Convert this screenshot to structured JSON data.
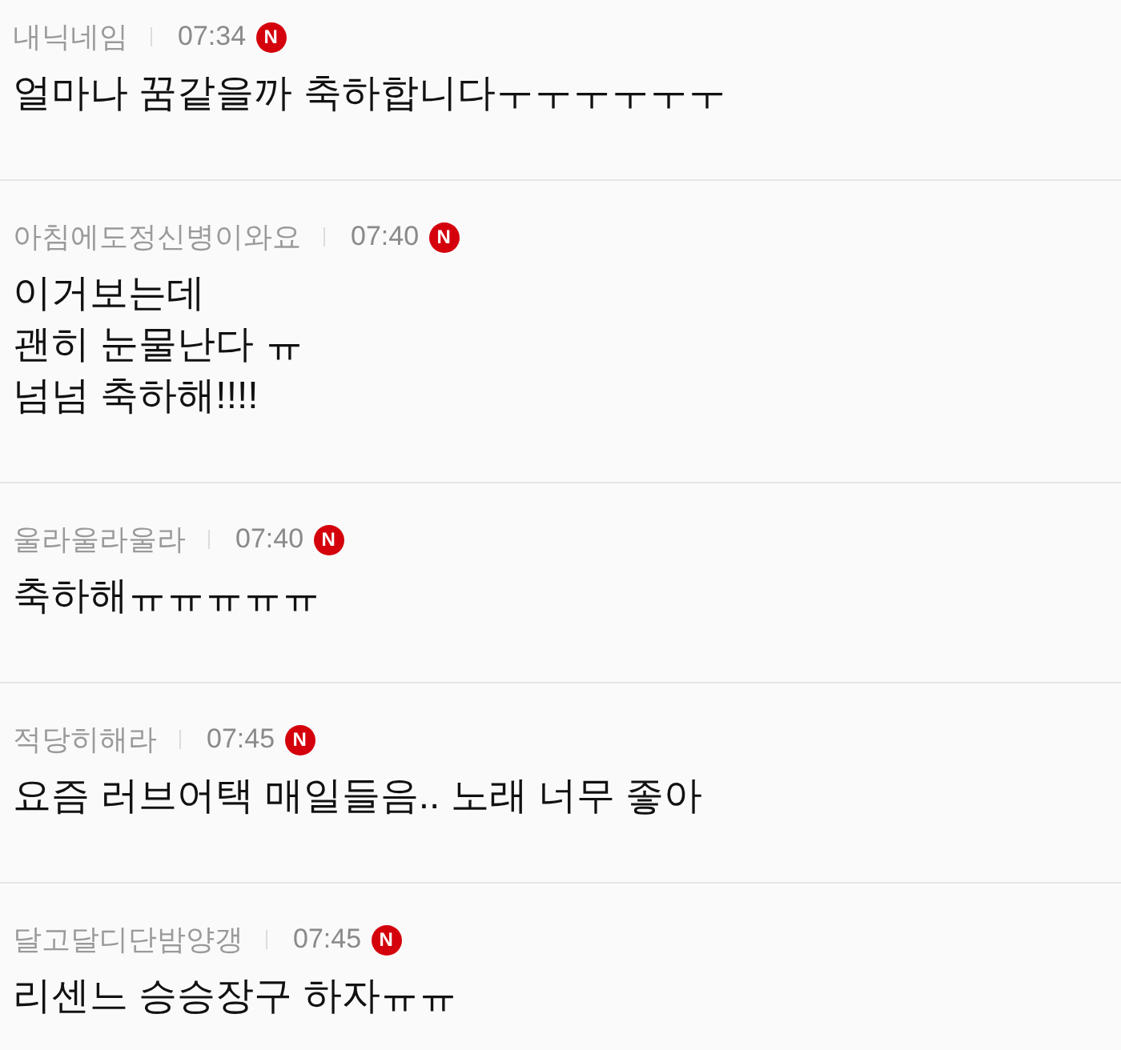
{
  "comments": [
    {
      "nickname": "내닉네임",
      "time": "07:34",
      "badge": "N",
      "text": "얼마나 꿈같을까 축하합니다ㅜㅜㅜㅜㅜㅜ"
    },
    {
      "nickname": "아침에도정신병이와요",
      "time": "07:40",
      "badge": "N",
      "text": "이거보는데\n괜히 눈물난다 ㅠ\n넘넘 축하해!!!!"
    },
    {
      "nickname": "울라울라울라",
      "time": "07:40",
      "badge": "N",
      "text": "축하해ㅠㅠㅠㅠㅠ"
    },
    {
      "nickname": "적당히해라",
      "time": "07:45",
      "badge": "N",
      "text": "요즘 러브어택 매일들음.. 노래 너무 좋아"
    },
    {
      "nickname": "달고달디단밤양갱",
      "time": "07:45",
      "badge": "N",
      "text": "리센느 승승장구 하자ㅠㅠ"
    }
  ]
}
